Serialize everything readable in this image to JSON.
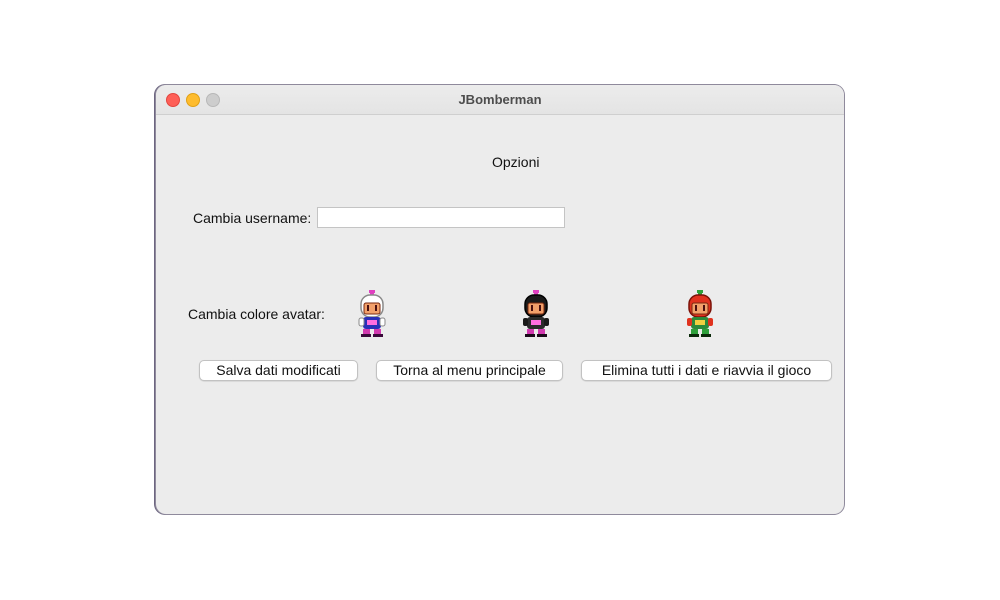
{
  "window": {
    "title": "JBomberman"
  },
  "options": {
    "heading": "Opzioni",
    "username_label": "Cambia username:",
    "username_value": "",
    "avatar_label": "Cambia colore avatar:",
    "avatars": [
      {
        "name": "white",
        "helmet": "#ffffff",
        "body": "#2a2fb8"
      },
      {
        "name": "black",
        "helmet": "#1a1a1a",
        "body": "#2b2b2b"
      },
      {
        "name": "red",
        "helmet": "#e0321e",
        "body": "#2c8a3a"
      }
    ]
  },
  "buttons": {
    "save": "Salva dati modificati",
    "menu": "Torna al menu principale",
    "reset": "Elimina tutti i dati e riavvia il gioco"
  }
}
